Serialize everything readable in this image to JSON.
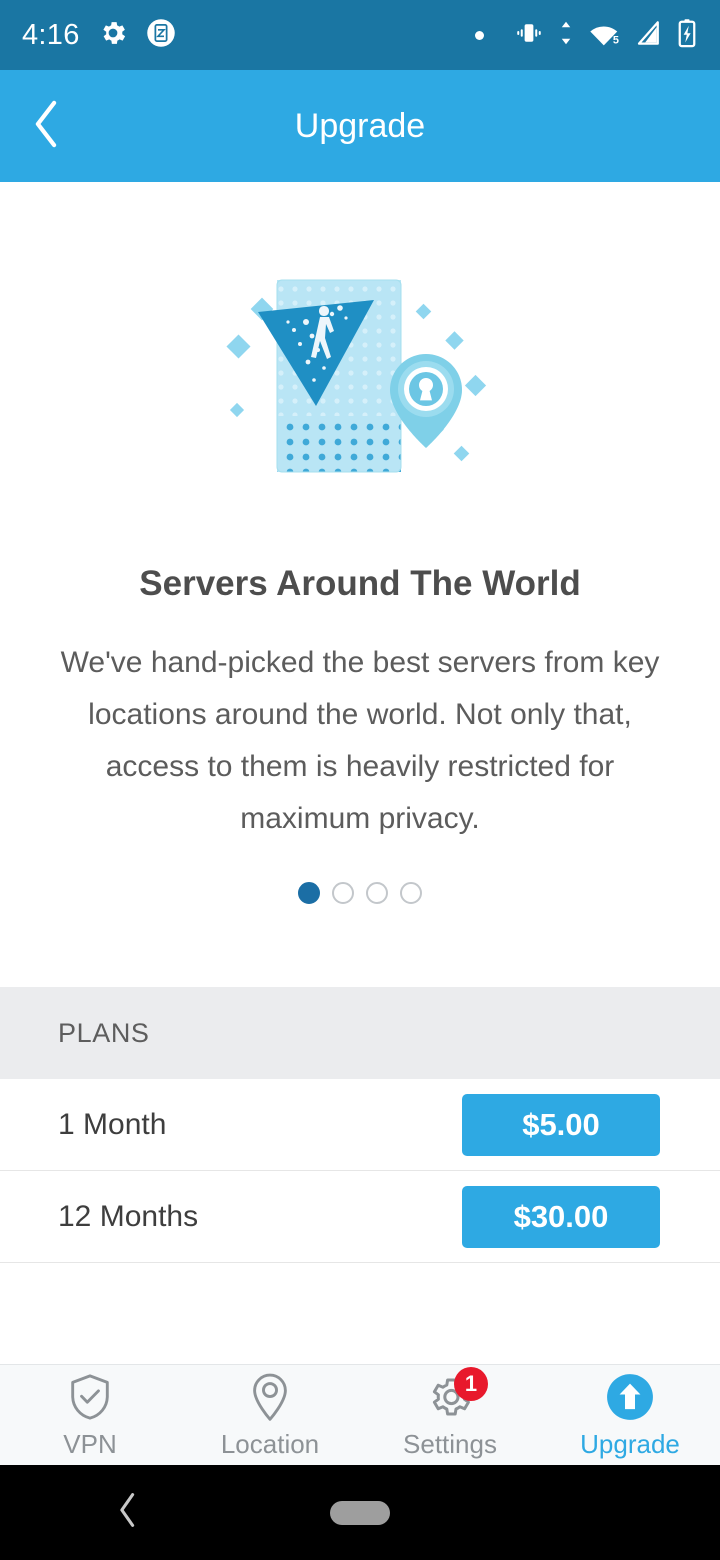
{
  "status_bar": {
    "time": "4:16",
    "left_icons": [
      "gear-icon",
      "screenshot-icon"
    ],
    "right_icons": [
      "dot-icon",
      "vibrate-icon",
      "data-transfer-icon",
      "wifi-icon",
      "cell-signal-icon",
      "battery-charging-icon"
    ],
    "wifi_label": "5",
    "background": "#1a76a3"
  },
  "header": {
    "title": "Upgrade",
    "back_icon": "chevron-left-icon",
    "background": "#2ea9e3"
  },
  "hero": {
    "illustration_name": "servers-around-world-illustration",
    "title": "Servers Around The World",
    "body": "We've hand-picked the best servers from key locations around the world. Not only that, access to them is heavily restricted for maximum privacy.",
    "pager": {
      "total": 4,
      "active_index": 0,
      "active_color": "#1b6ea5",
      "inactive_color": "#c3c7cb"
    }
  },
  "plans": {
    "section_title": "PLANS",
    "section_background": "#ebecee",
    "button_color": "#2ea9e3",
    "rows": [
      {
        "name": "1 Month",
        "price": "$5.00"
      },
      {
        "name": "12 Months",
        "price": "$30.00"
      }
    ]
  },
  "tabbar": {
    "active_color": "#2ea9e3",
    "inactive_color": "#8d9296",
    "items": [
      {
        "label": "VPN",
        "icon": "shield-check-icon",
        "badge": null,
        "active": false
      },
      {
        "label": "Location",
        "icon": "map-pin-icon",
        "badge": null,
        "active": false
      },
      {
        "label": "Settings",
        "icon": "gear-icon",
        "badge": "1",
        "active": false
      },
      {
        "label": "Upgrade",
        "icon": "arrow-up-circle-icon",
        "badge": null,
        "active": true
      }
    ]
  },
  "navbar": {
    "back_icon": "chevron-left-icon",
    "home_pill": "home-pill"
  }
}
